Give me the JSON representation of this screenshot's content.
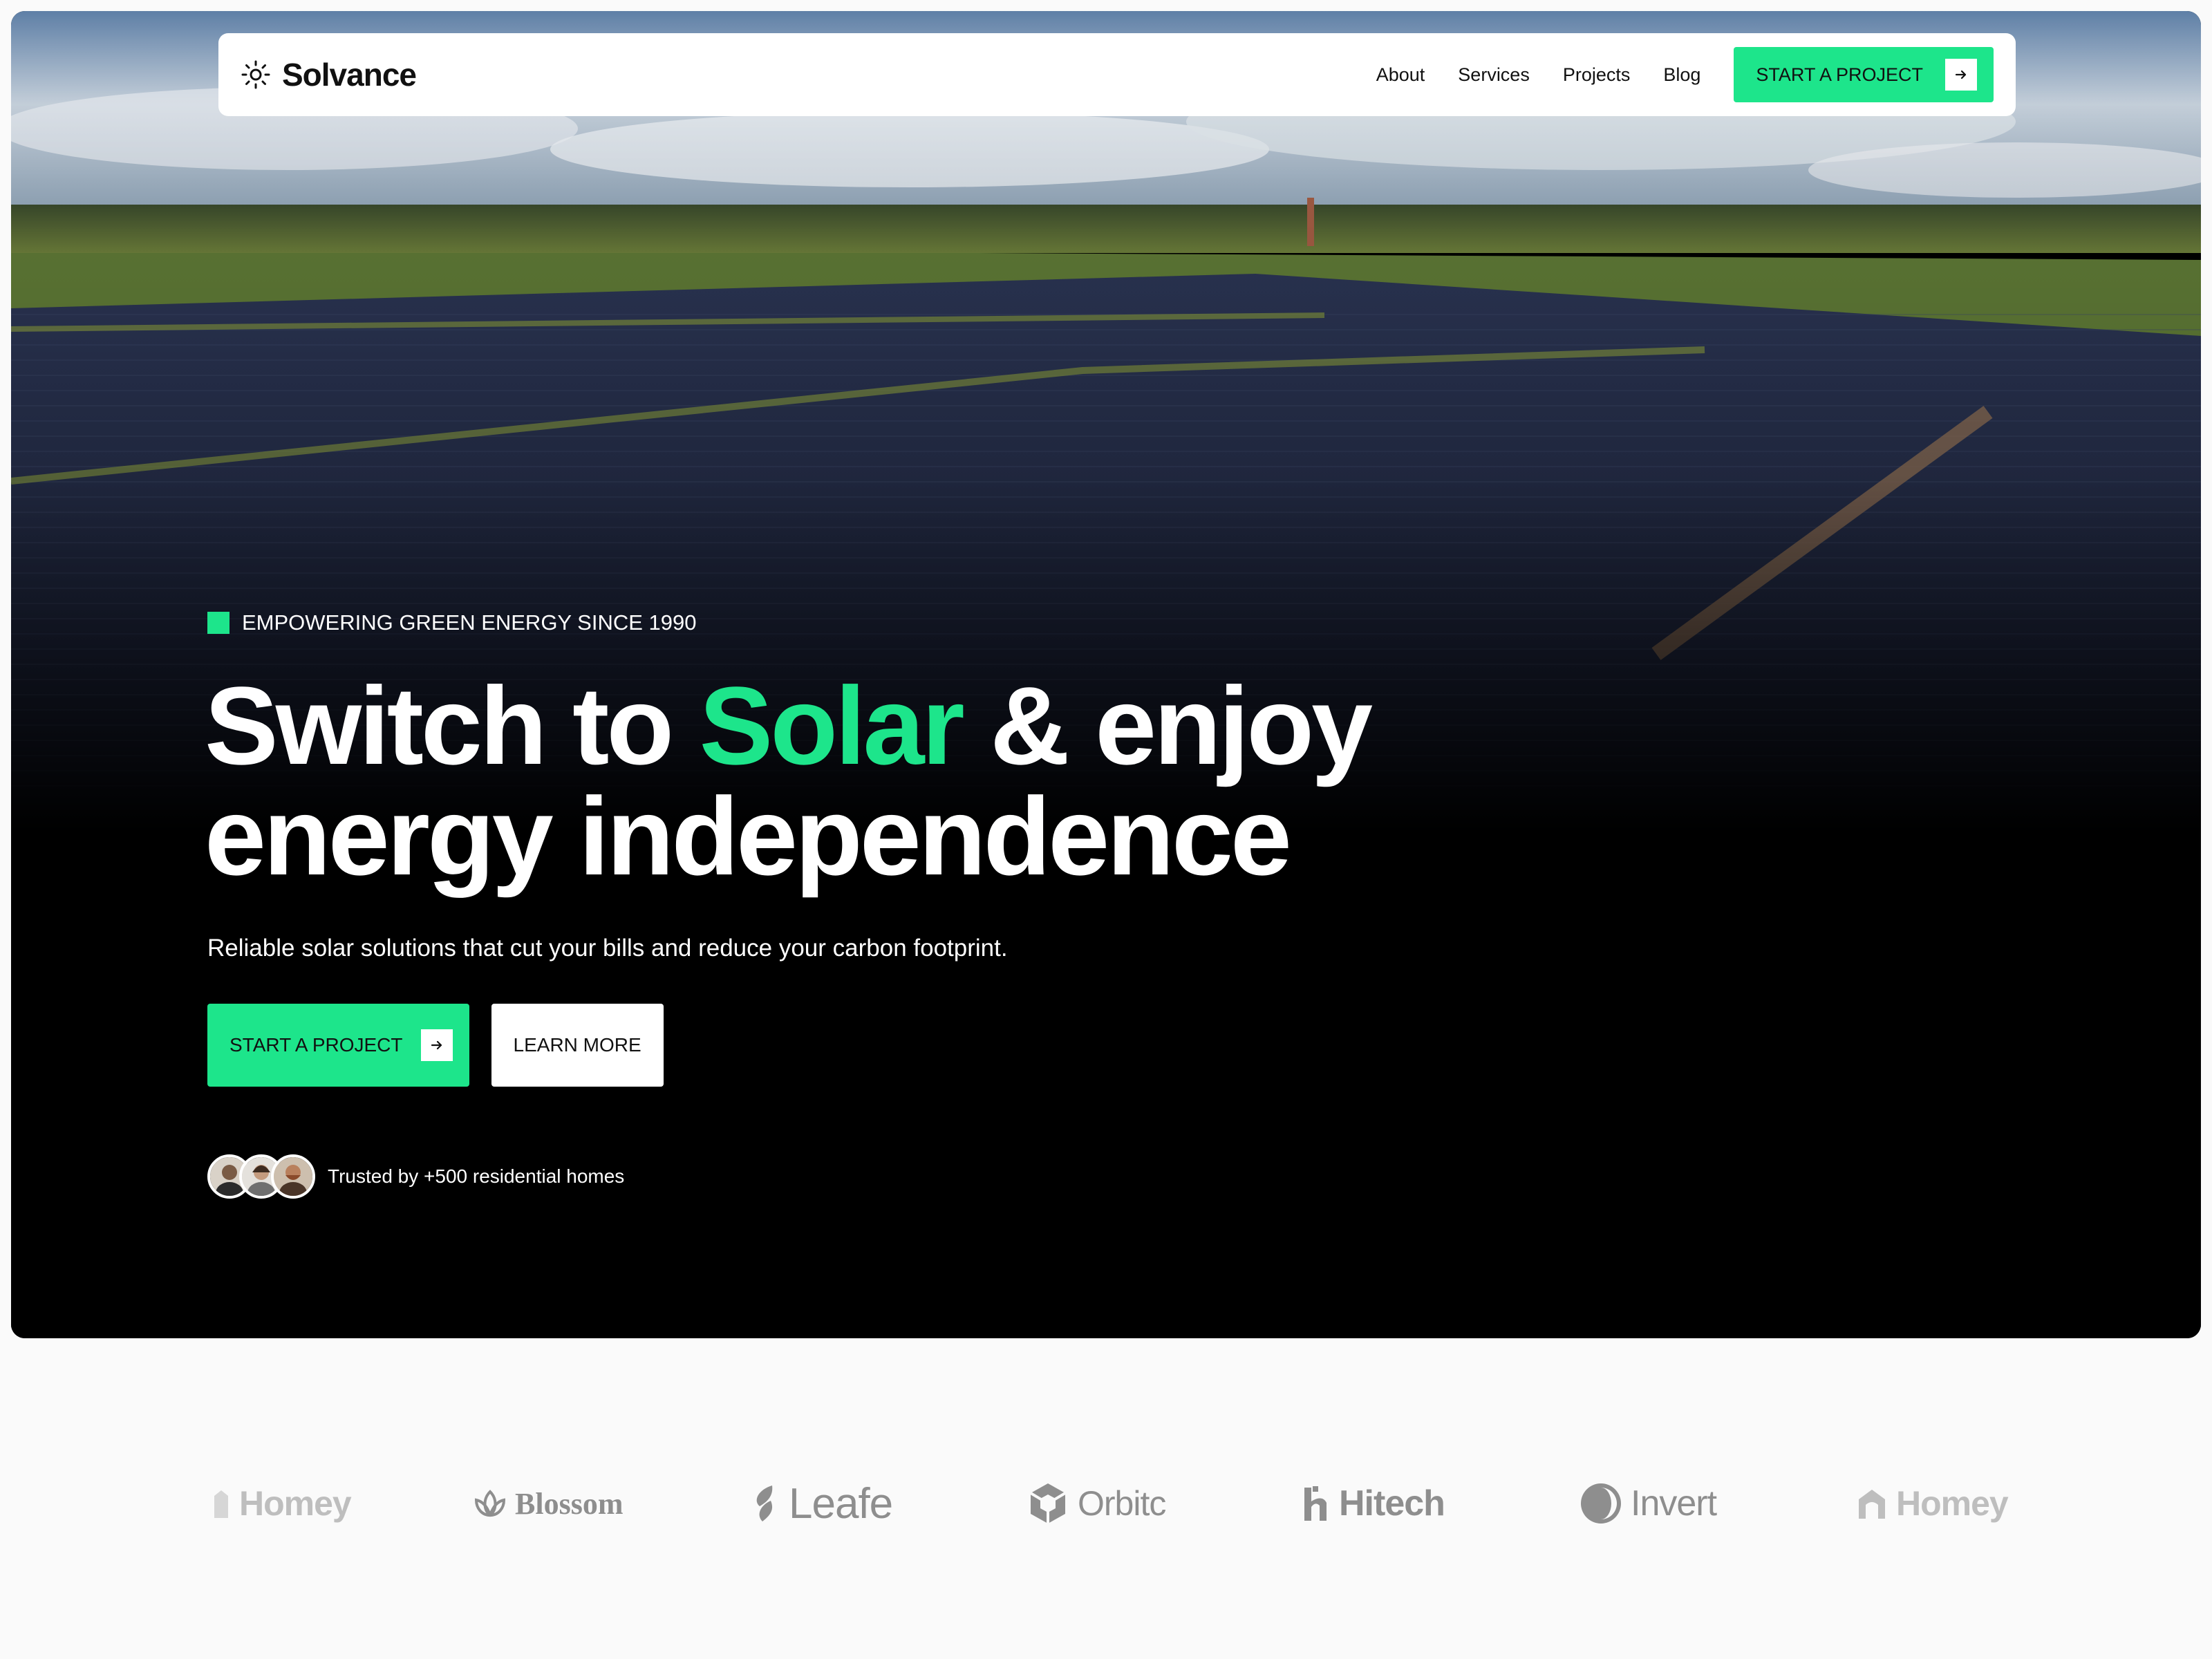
{
  "nav": {
    "brand": "Solvance",
    "links": [
      "About",
      "Services",
      "Projects",
      "Blog"
    ],
    "cta_label": "START A PROJECT"
  },
  "hero": {
    "eyebrow": "EMPOWERING GREEN ENERGY SINCE 1990",
    "headline_pre": "Switch to ",
    "headline_accent": "Solar",
    "headline_post": " & enjoy",
    "headline_line2": "energy independence",
    "subtext": "Reliable solar solutions that cut your bills and reduce your carbon footprint.",
    "primary_cta": "START A PROJECT",
    "secondary_cta": "LEARN MORE",
    "trust_text": "Trusted by +500 residential homes"
  },
  "logos": [
    "Homey",
    "Blossom",
    "Leafe",
    "Orbitc",
    "Hitech",
    "Invert",
    "Homey"
  ],
  "colors": {
    "accent": "#1de58b",
    "background": "#fafafa",
    "hero_dark": "#000000",
    "logo_gray": "#8e8e8e"
  },
  "icons": {
    "brand": "sun-icon",
    "cta": "arrow-right-icon"
  }
}
